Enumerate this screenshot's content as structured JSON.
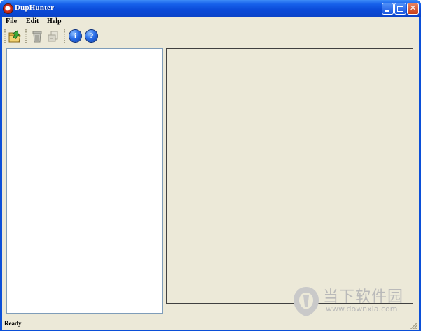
{
  "window": {
    "title": "DupHunter",
    "app_icon": "duphunter-app-icon",
    "controls": {
      "minimize_icon": "minimize-icon",
      "maximize_icon": "maximize-icon",
      "close_label": "✕"
    }
  },
  "menu": {
    "file": {
      "accel": "F",
      "rest": "ile"
    },
    "edit": {
      "accel": "E",
      "rest": "dit"
    },
    "help": {
      "accel": "H",
      "rest": "elp"
    }
  },
  "toolbar": {
    "items": [
      {
        "name": "open-folder-button",
        "icon": "open-folder-icon",
        "enabled": true
      },
      {
        "name": "delete-button",
        "icon": "trash-icon",
        "enabled": false
      },
      {
        "name": "move-button",
        "icon": "move-file-icon",
        "enabled": false
      },
      {
        "name": "info-button",
        "icon": "info-icon",
        "label": "i",
        "enabled": true
      },
      {
        "name": "help-button",
        "icon": "help-icon",
        "label": "?",
        "enabled": true
      }
    ]
  },
  "status": {
    "text": "Ready"
  },
  "watermark": {
    "cn_text": "当下软件园",
    "url": "www.downxia.com"
  },
  "colors": {
    "titlebar": "#0a4ad8",
    "face": "#ece9d8",
    "pane_border": "#7f9db9"
  }
}
